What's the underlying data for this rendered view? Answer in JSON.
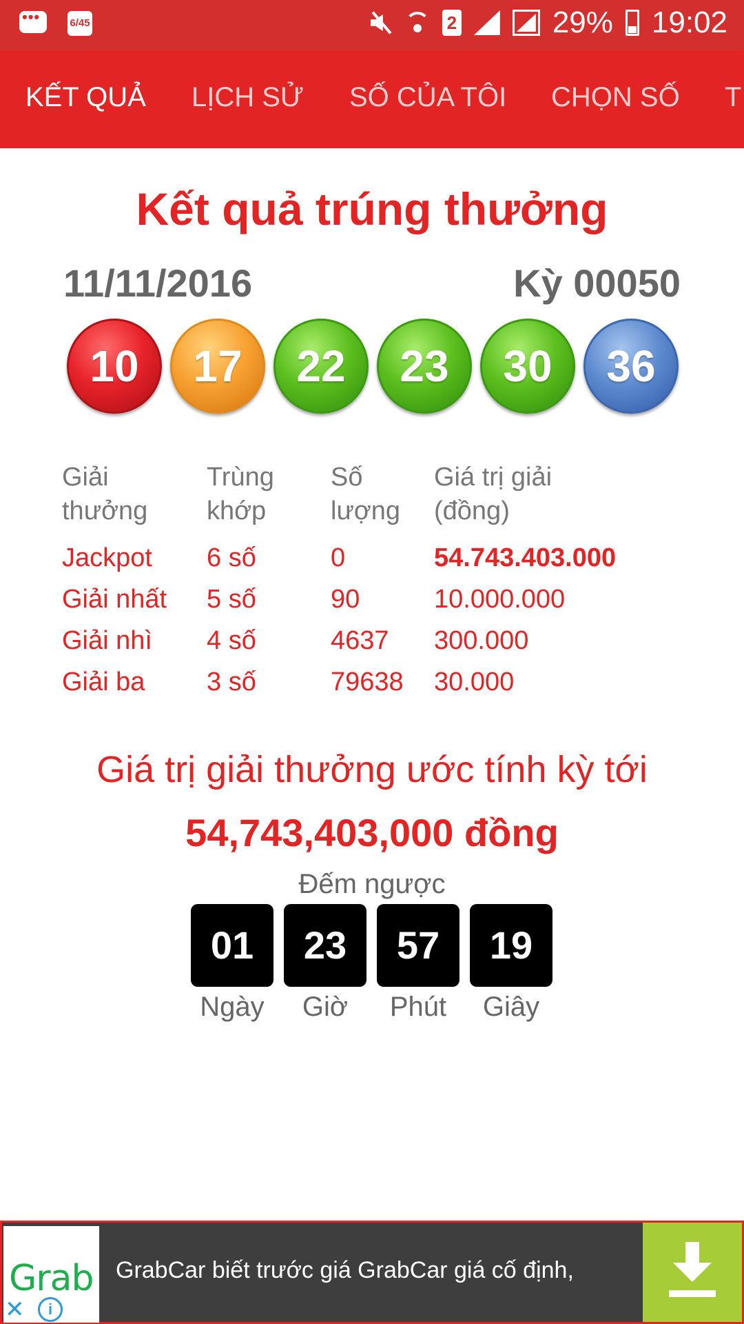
{
  "status_bar": {
    "lotto_icon_text": "6/45",
    "sim": "2",
    "battery": "29%",
    "time": "19:02"
  },
  "tabs": [
    {
      "label": "KẾT QUẢ",
      "active": true
    },
    {
      "label": "LỊCH SỬ",
      "active": false
    },
    {
      "label": "SỐ CỦA TÔI",
      "active": false
    },
    {
      "label": "CHỌN SỐ",
      "active": false
    },
    {
      "label": "T",
      "active": false
    }
  ],
  "result": {
    "title": "Kết quả trúng thưởng",
    "date": "11/11/2016",
    "draw": "Kỳ 00050",
    "balls": [
      {
        "number": "10",
        "color": "red"
      },
      {
        "number": "17",
        "color": "orange"
      },
      {
        "number": "22",
        "color": "green"
      },
      {
        "number": "23",
        "color": "green"
      },
      {
        "number": "30",
        "color": "green"
      },
      {
        "number": "36",
        "color": "blue"
      }
    ]
  },
  "prize_table": {
    "headers": [
      "Giải thưởng",
      "Trùng khớp",
      "Số lượng",
      "Giá trị giải (đồng)"
    ],
    "rows": [
      [
        "Jackpot",
        "6 số",
        "0",
        "54.743.403.000"
      ],
      [
        "Giải nhất",
        "5 số",
        "90",
        "10.000.000"
      ],
      [
        "Giải nhì",
        "4 số",
        "4637",
        "300.000"
      ],
      [
        "Giải ba",
        "3 số",
        "79638",
        "30.000"
      ]
    ]
  },
  "estimate": {
    "label": "Giá trị giải thưởng ước tính kỳ tới",
    "value": "54,743,403,000 đồng"
  },
  "countdown": {
    "label": "Đếm ngược",
    "items": [
      {
        "value": "01",
        "unit": "Ngày"
      },
      {
        "value": "23",
        "unit": "Giờ"
      },
      {
        "value": "57",
        "unit": "Phút"
      },
      {
        "value": "19",
        "unit": "Giây"
      }
    ]
  },
  "ad": {
    "logo_text": "Grab",
    "close": "✕",
    "info": "i",
    "text": "GrabCar biết trước giá GrabCar giá cố định,"
  },
  "colors": {
    "primary_red": "#e22425",
    "status_bar": "#d32f2f",
    "download_green": "#a6cd37"
  }
}
